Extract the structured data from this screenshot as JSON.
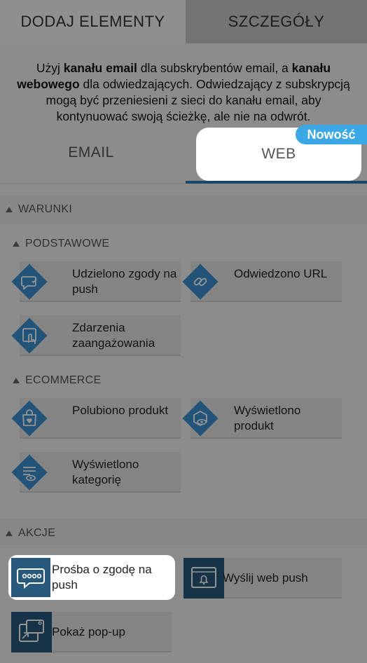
{
  "top_tabs": {
    "add_elements": "DODAJ ELEMENTY",
    "details": "SZCZEGÓŁY"
  },
  "intro": {
    "p1": "Użyj ",
    "b1": "kanału email",
    "p2": " dla subskrybentów email, a ",
    "b2": "kanału webowego",
    "p3": " dla odwiedzających. Odwiedzający z subskrypcją mogą być przeniesieni z sieci do kanału email, aby kontynuować swoją ścieżkę, ale nie na odwrót."
  },
  "channel_tabs": {
    "email": "EMAIL",
    "web": "WEB",
    "new_badge": "Nowość"
  },
  "conditions": {
    "title": "WARUNKI",
    "basic": {
      "title": "PODSTAWOWE",
      "items": [
        "Udzielono zgody na push",
        "Odwiedzono URL",
        "Zdarzenia zaangażowania"
      ]
    },
    "ecommerce": {
      "title": "ECOMMERCE",
      "items": [
        "Polubiono produkt",
        "Wyświetlono produkt",
        "Wyświetlono kategorię"
      ]
    }
  },
  "actions": {
    "title": "AKCJE",
    "items": [
      "Prośba o zgodę na push",
      "Wyślij web push",
      "Pokaż pop-up"
    ]
  },
  "colors": {
    "condition_icon": "#3b8fd0",
    "action_icon": "#27597c",
    "active_tab_underline": "#2f78b5",
    "badge": "#3da8e6"
  }
}
